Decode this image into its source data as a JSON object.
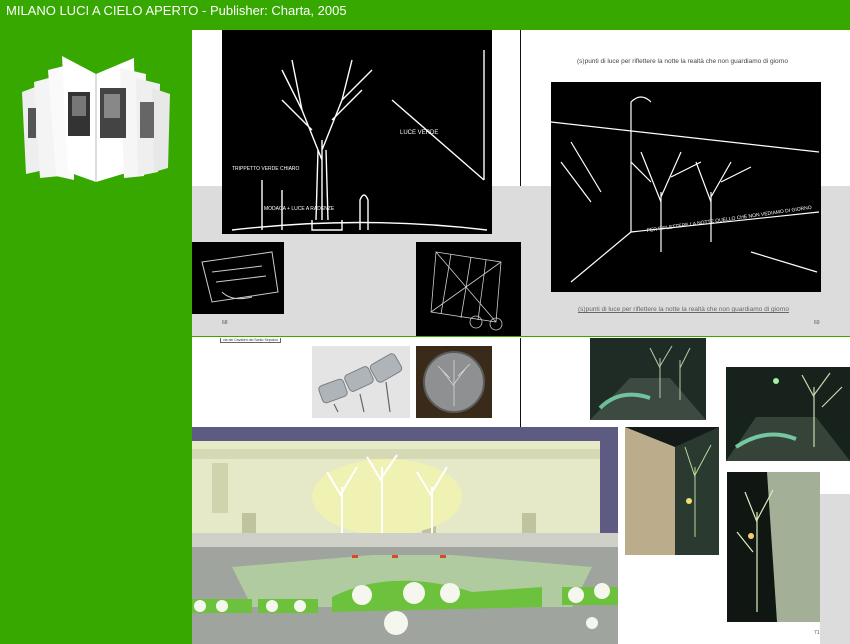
{
  "header": {
    "title": "MILANO LUCI A CIELO APERTO - Publisher: Charta, 2005"
  },
  "spread1": {
    "right_top_caption": "(s)punti di luce per riflettere la notte la realtà che non guardiamo di giorno",
    "right_bottom_caption": "(s)punti di luce per riflettere la notte la realtà che non guardiamo di giorno",
    "left_page_number": "68",
    "right_page_number": "69",
    "sketch_text_1": "LUCE VERDE",
    "sketch_text_2": "TRIPPETTO VERDE CHIARO",
    "sketch_text_3": "MODACA + LUCE A RADENZE",
    "sketch_text_4": "PER RIFLETTERE LA NOTTE QUELLO CHE NON VEDIAMO DI GIORNO"
  },
  "spread2": {
    "street_label": "via dei Cavalieri del Santo Sepolcro",
    "right_page_number": "71"
  },
  "colors": {
    "brand_green": "#36a800",
    "page_gray": "#dcdcdc"
  },
  "icons": {
    "book": "open-book-icon"
  }
}
